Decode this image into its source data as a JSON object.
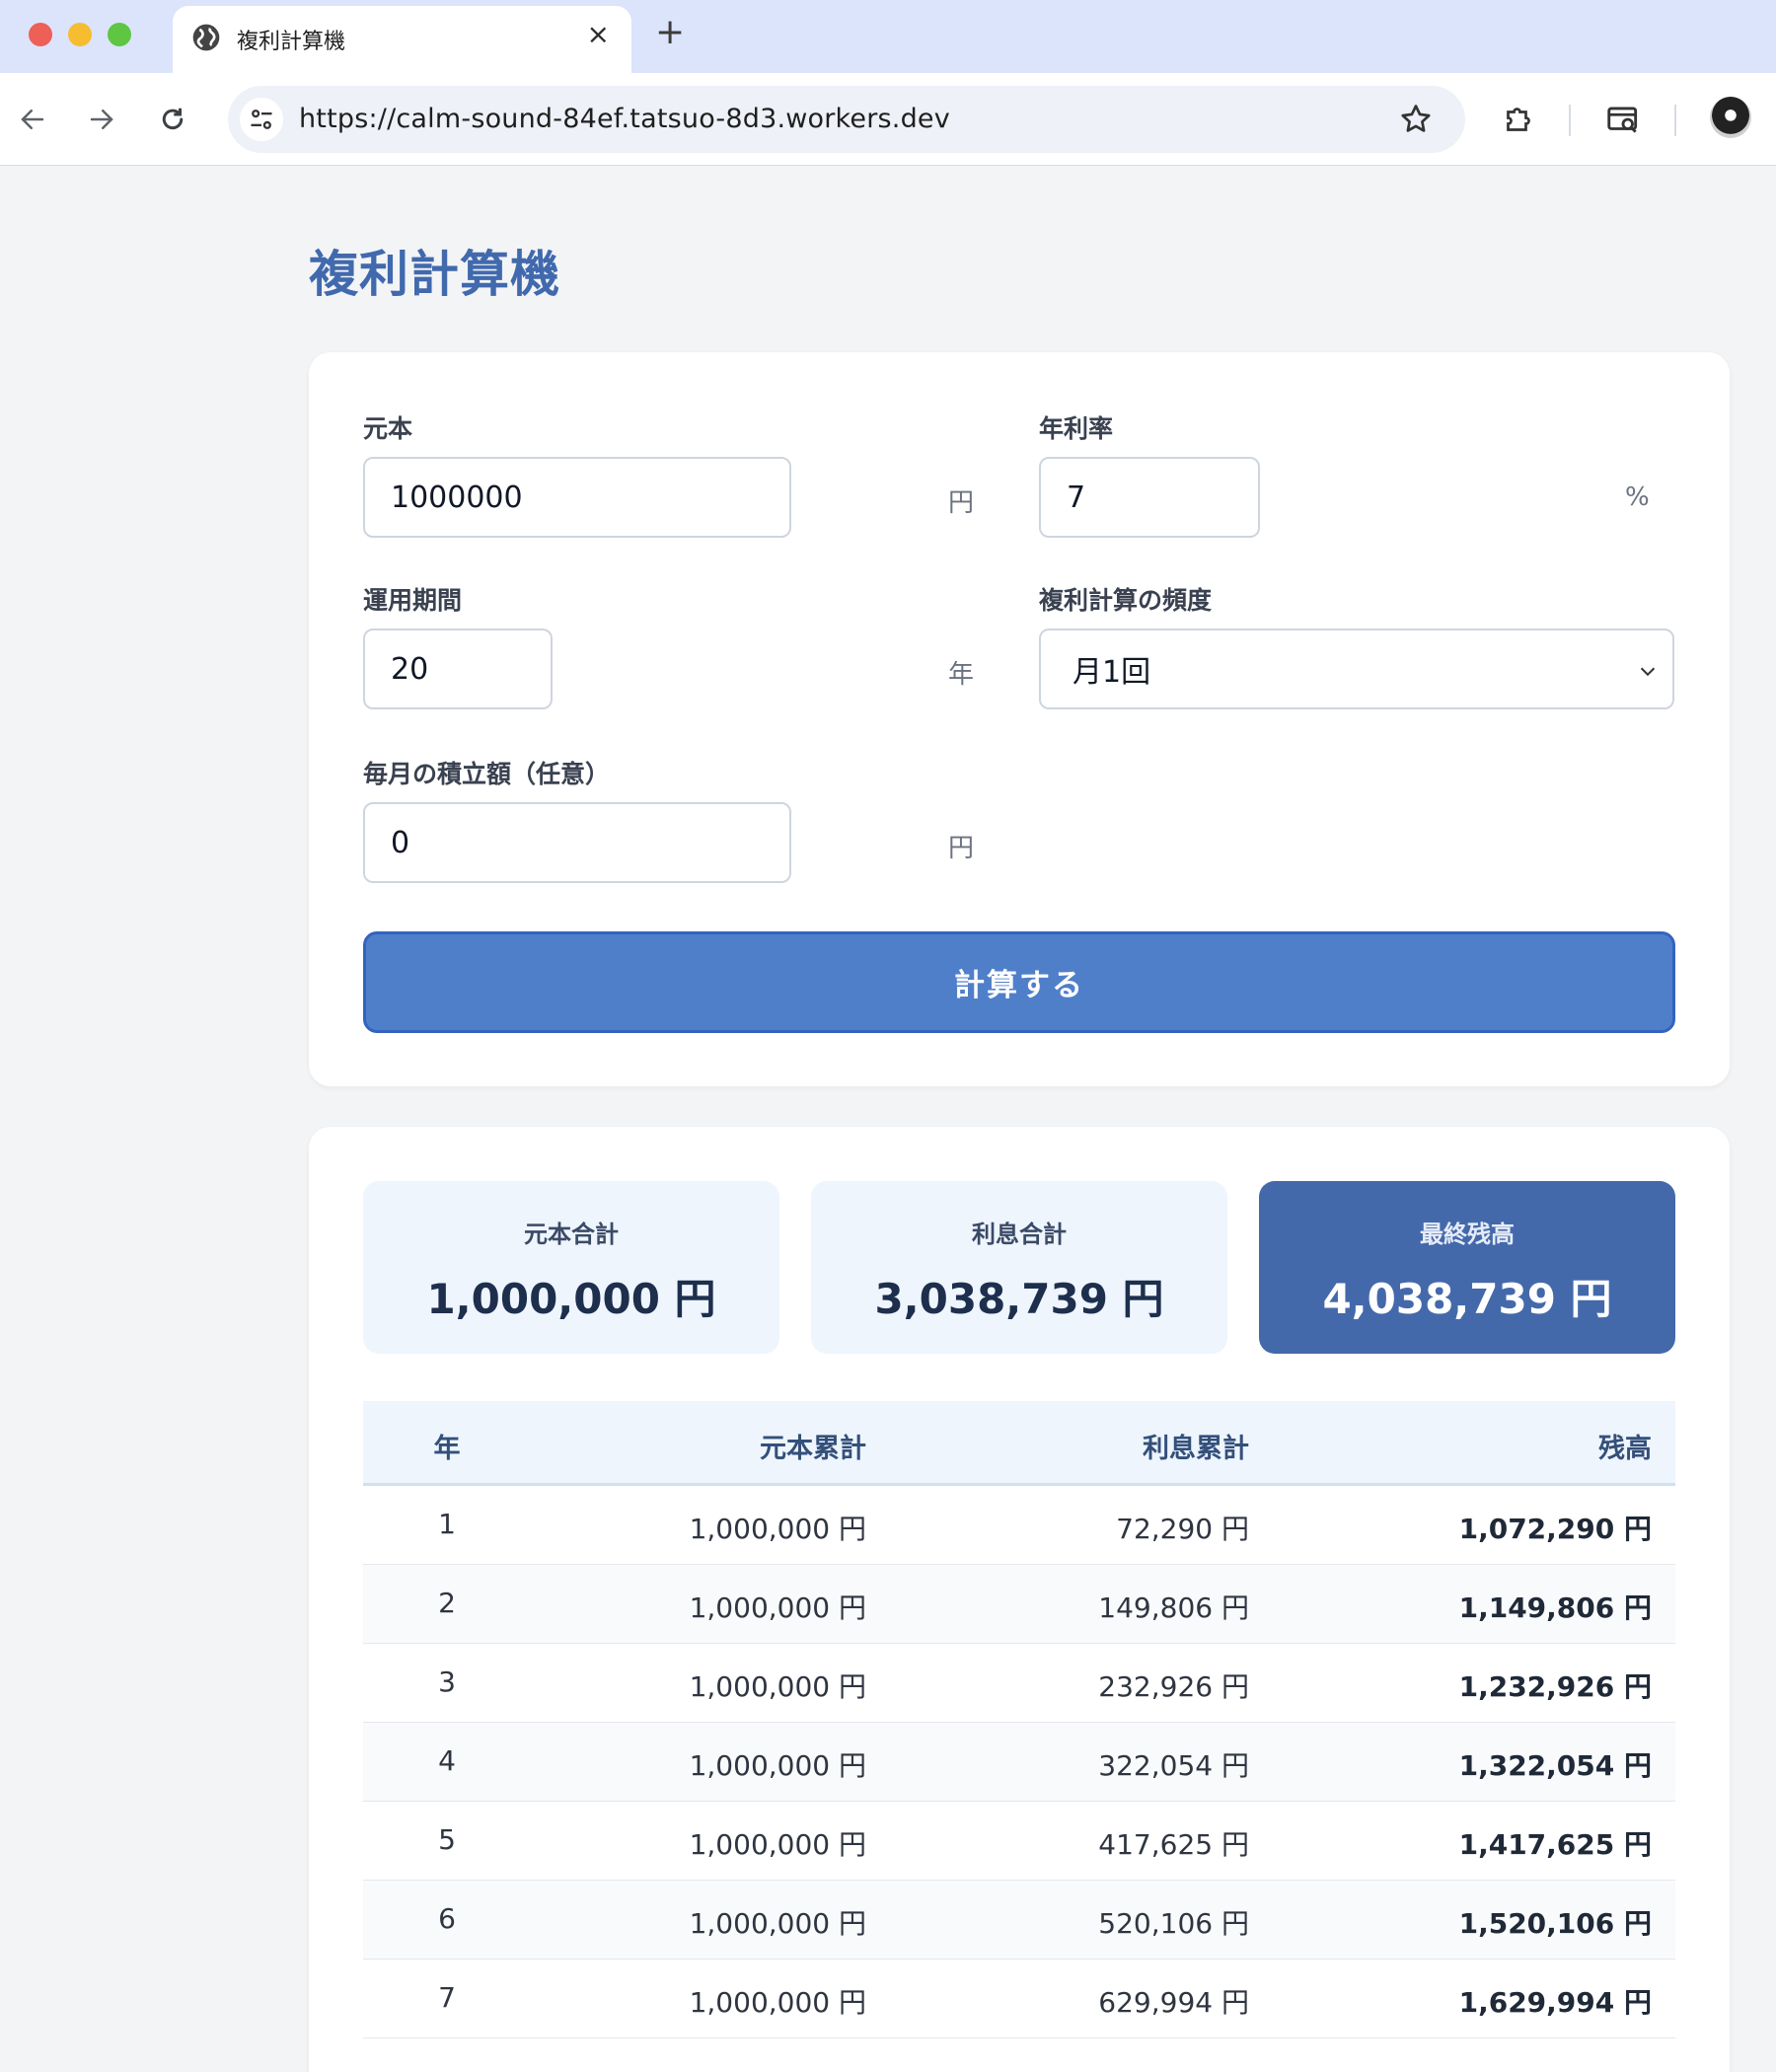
{
  "browser": {
    "tab_title": "複利計算機",
    "tab_close": "×",
    "new_tab": "+",
    "url": "https://calm-sound-84ef.tatsuo-8d3.workers.dev"
  },
  "page": {
    "title": "複利計算機"
  },
  "form": {
    "principal": {
      "label": "元本",
      "value": "1000000",
      "unit": "円"
    },
    "rate": {
      "label": "年利率",
      "value": "7",
      "unit": "%"
    },
    "period": {
      "label": "運用期間",
      "value": "20",
      "unit": "年"
    },
    "frequency": {
      "label": "複利計算の頻度",
      "value": "月1回"
    },
    "monthly": {
      "label": "毎月の積立額（任意）",
      "value": "0",
      "unit": "円"
    },
    "submit_label": "計算する"
  },
  "summary": {
    "principal": {
      "label": "元本合計",
      "value": "1,000,000 円"
    },
    "interest": {
      "label": "利息合計",
      "value": "3,038,739 円"
    },
    "balance": {
      "label": "最終残高",
      "value": "4,038,739 円"
    }
  },
  "table": {
    "headers": {
      "year": "年",
      "principal": "元本累計",
      "interest": "利息累計",
      "balance": "残高"
    },
    "rows": [
      {
        "year": "1",
        "principal": "1,000,000 円",
        "interest": "72,290 円",
        "balance": "1,072,290 円"
      },
      {
        "year": "2",
        "principal": "1,000,000 円",
        "interest": "149,806 円",
        "balance": "1,149,806 円"
      },
      {
        "year": "3",
        "principal": "1,000,000 円",
        "interest": "232,926 円",
        "balance": "1,232,926 円"
      },
      {
        "year": "4",
        "principal": "1,000,000 円",
        "interest": "322,054 円",
        "balance": "1,322,054 円"
      },
      {
        "year": "5",
        "principal": "1,000,000 円",
        "interest": "417,625 円",
        "balance": "1,417,625 円"
      },
      {
        "year": "6",
        "principal": "1,000,000 円",
        "interest": "520,106 円",
        "balance": "1,520,106 円"
      },
      {
        "year": "7",
        "principal": "1,000,000 円",
        "interest": "629,994 円",
        "balance": "1,629,994 円"
      }
    ]
  }
}
